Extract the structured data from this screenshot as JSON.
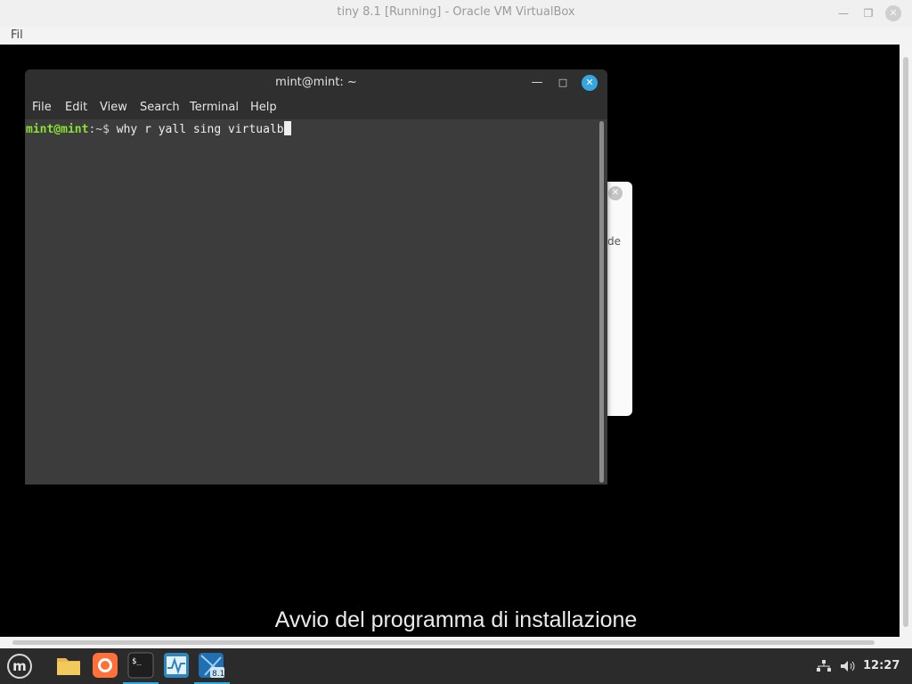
{
  "host_window": {
    "title": "tiny 8.1 [Running] - Oracle VM VirtualBox",
    "menu_first": "Fil",
    "minimize_glyph": "—",
    "maximize_glyph": "❐",
    "close_glyph": "✕"
  },
  "terminal": {
    "title": "mint@mint: ~",
    "menu": [
      "File",
      "Edit",
      "View",
      "Search",
      "Terminal",
      "Help"
    ],
    "prompt_user": "mint@mint",
    "prompt_sep": ":",
    "prompt_path": "~$",
    "command": " why r yall sing virtualb",
    "minimize_glyph": "—",
    "maximize_glyph": "□",
    "close_glyph": "✕"
  },
  "installer_dialog": {
    "close_glyph": "✕",
    "partial_text": "de"
  },
  "subtitle": "Avvio del programma di installazione",
  "taskbar": {
    "menu_glyph": "m",
    "clock": "12:27",
    "apps": [
      {
        "name": "file-manager",
        "color": "#e8b84b"
      },
      {
        "name": "firefox",
        "color": "#ff7139"
      },
      {
        "name": "terminal",
        "color": "#1e1e1e",
        "label": "$_"
      },
      {
        "name": "system-monitor",
        "color": "#2e86c1"
      },
      {
        "name": "virtualbox-vm",
        "color": "#1f6fb2",
        "label": "8.1"
      }
    ]
  }
}
